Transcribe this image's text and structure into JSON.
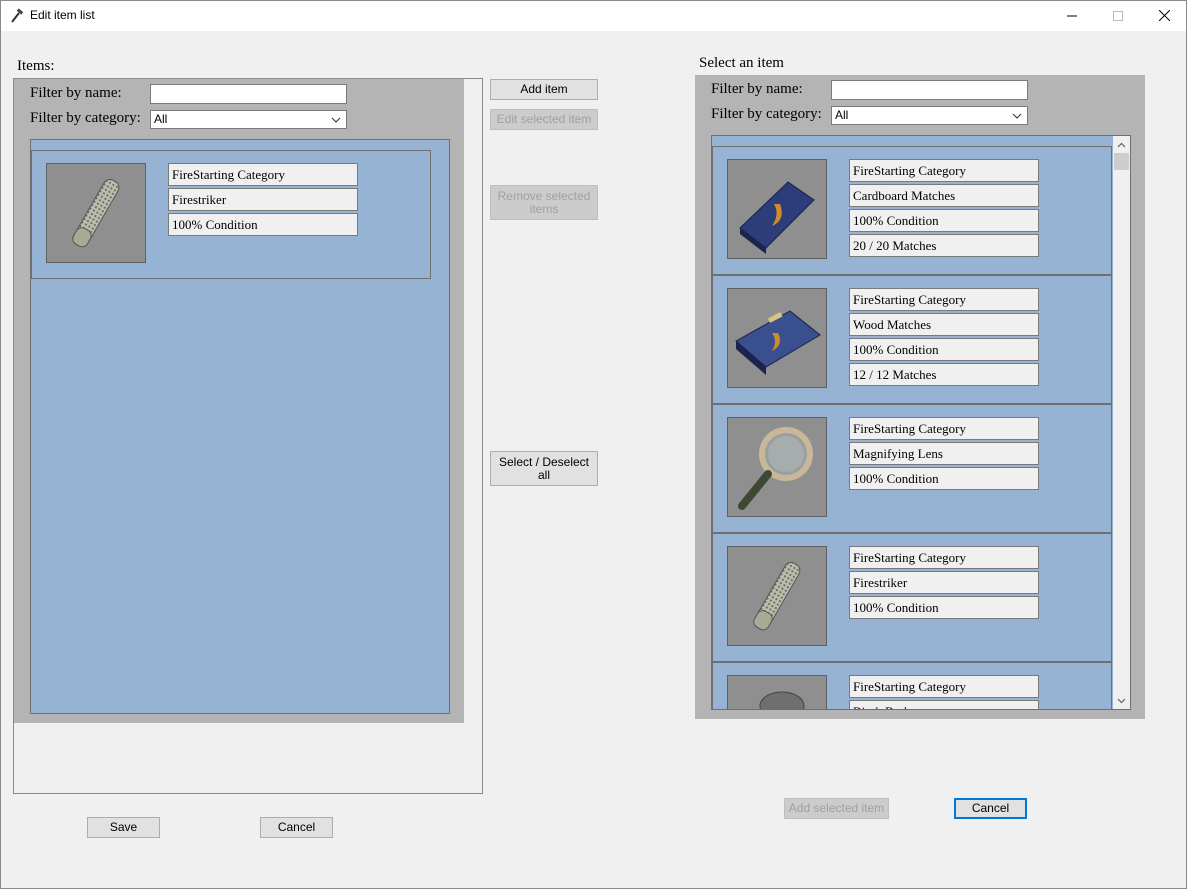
{
  "window": {
    "title": "Edit item list"
  },
  "left": {
    "section_label": "Items:",
    "filter_name_label": "Filter by name:",
    "filter_name_value": "",
    "filter_category_label": "Filter by category:",
    "filter_category_value": "All",
    "items": [
      {
        "icon": "firestriker-icon",
        "fields": [
          "FireStarting Category",
          "Firestriker",
          "100% Condition"
        ]
      }
    ],
    "save_label": "Save",
    "cancel_label": "Cancel"
  },
  "middle": {
    "add_item": "Add item",
    "edit_selected": "Edit selected item",
    "remove_selected_line1": "Remove selected",
    "remove_selected_line2": "items",
    "select_deselect_line1": "Select / Deselect",
    "select_deselect_line2": "all"
  },
  "right": {
    "section_label": "Select an item",
    "filter_name_label": "Filter by name:",
    "filter_name_value": "",
    "filter_category_label": "Filter by category:",
    "filter_category_value": "All",
    "items": [
      {
        "icon": "cardboard-matches-icon",
        "fields": [
          "FireStarting Category",
          "Cardboard Matches",
          "100% Condition",
          "20 / 20 Matches"
        ]
      },
      {
        "icon": "wood-matches-icon",
        "fields": [
          "FireStarting Category",
          "Wood Matches",
          "100% Condition",
          "12 / 12 Matches"
        ]
      },
      {
        "icon": "magnifying-lens-icon",
        "fields": [
          "FireStarting Category",
          "Magnifying Lens",
          "100% Condition"
        ]
      },
      {
        "icon": "firestriker-icon",
        "fields": [
          "FireStarting Category",
          "Firestriker",
          "100% Condition"
        ]
      },
      {
        "icon": "flare-icon",
        "fields": [
          "FireStarting Category",
          "Birch Bark"
        ]
      }
    ],
    "add_selected_label": "Add selected item",
    "cancel_label": "Cancel"
  }
}
